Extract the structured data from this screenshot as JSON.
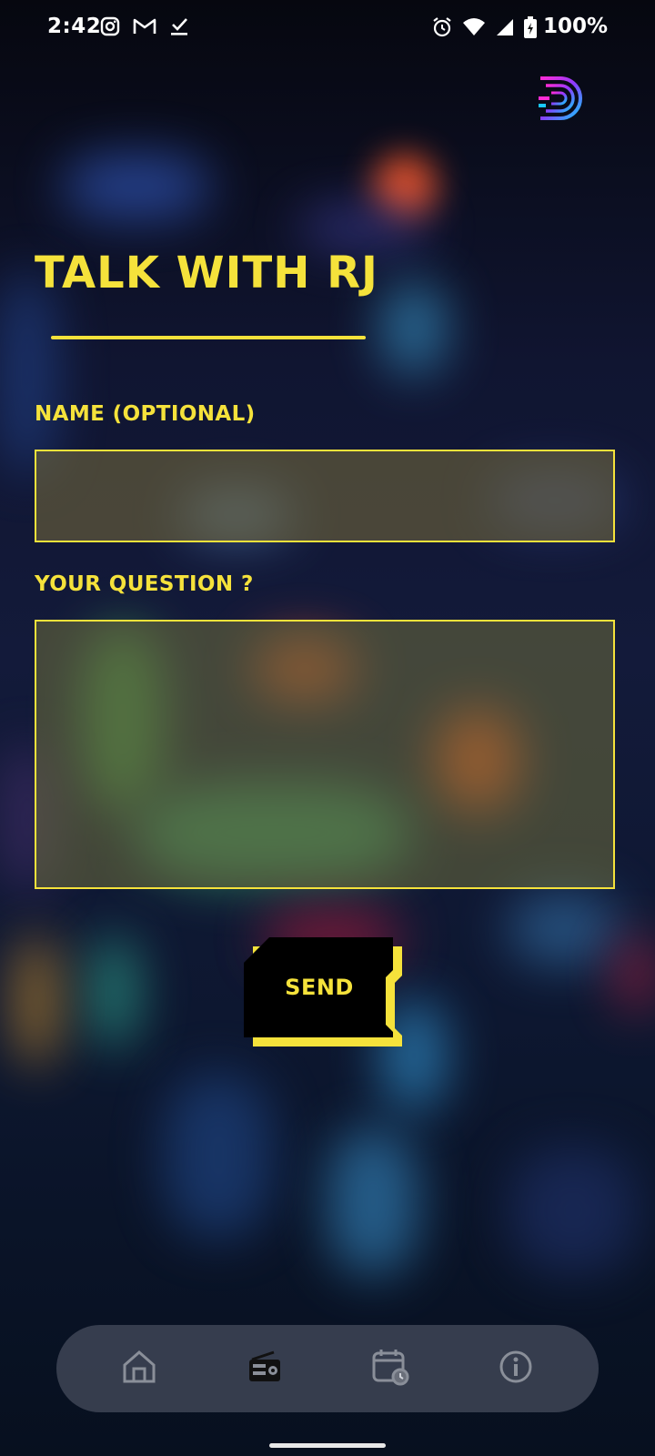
{
  "status_bar": {
    "time": "2:42",
    "battery": "100%",
    "left_icons": [
      "instagram-icon",
      "gmail-icon",
      "check-download-icon"
    ],
    "right_icons": [
      "alarm-icon",
      "wifi-icon",
      "signal-icon",
      "battery-icon"
    ]
  },
  "header": {
    "logo": "app-logo"
  },
  "page": {
    "title": "TALK WITH RJ"
  },
  "form": {
    "name_label": "NAME (OPTIONAL)",
    "name_value": "",
    "name_placeholder": "",
    "question_label": "YOUR QUESTION ?",
    "question_value": "",
    "question_placeholder": "",
    "send_label": "SEND"
  },
  "bottom_nav": {
    "items": [
      {
        "icon": "home-icon",
        "active": false
      },
      {
        "icon": "radio-icon",
        "active": true
      },
      {
        "icon": "schedule-icon",
        "active": false
      },
      {
        "icon": "info-icon",
        "active": false
      }
    ]
  },
  "colors": {
    "accent": "#f5e23b",
    "background": "#0b0e1f"
  }
}
